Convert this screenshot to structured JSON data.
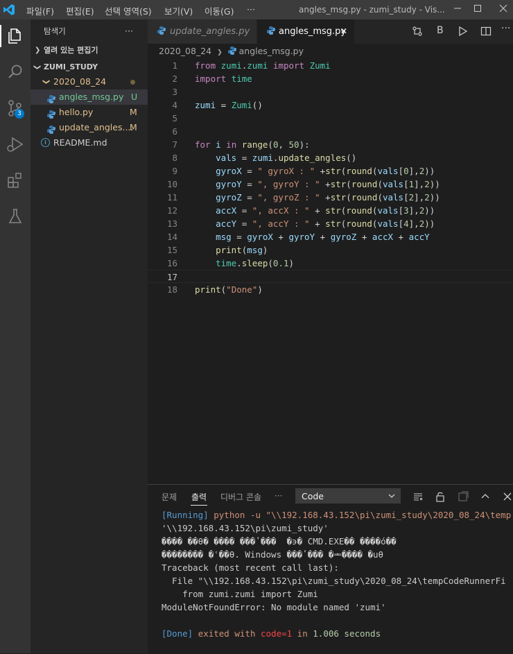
{
  "titlebar": {
    "menus": [
      "파일(F)",
      "편집(E)",
      "선택 영역(S)",
      "보기(V)",
      "이동(G)",
      "···"
    ],
    "window_title": "angles_msg.py - zumi_study - Vis..."
  },
  "activity_bar": {
    "icons": [
      "explorer-icon",
      "search-icon",
      "source-control-icon",
      "run-debug-icon",
      "extensions-icon",
      "testing-icon"
    ],
    "source_control_badge": "3"
  },
  "sidebar": {
    "title": "탐색기",
    "more": "···",
    "open_editors": "열려 있는 편집기",
    "workspace": "ZUMI_STUDY",
    "folder": "2020_08_24",
    "files": [
      {
        "name": "angles_msg.py",
        "status": "U"
      },
      {
        "name": "hello.py",
        "status": "M"
      },
      {
        "name": "update_angles....",
        "status": "M"
      }
    ],
    "readme": "README.md"
  },
  "tabs": [
    {
      "label": "update_angles.py"
    },
    {
      "label": "angles_msg.py",
      "close": "✕"
    }
  ],
  "breadcrumb": {
    "folder": "2020_08_24",
    "file": "angles_msg.py"
  },
  "code": {
    "line_numbers": [
      "1",
      "2",
      "3",
      "4",
      "5",
      "6",
      "7",
      "8",
      "9",
      "10",
      "11",
      "12",
      "13",
      "14",
      "15",
      "16",
      "17",
      "18"
    ],
    "lines": [
      "from zumi.zumi import Zumi",
      "import time",
      "",
      "zumi = Zumi()",
      "",
      "",
      "for i in range(0, 50):",
      "    vals = zumi.update_angles()",
      "    gyroX = \" gyroX : \" +str(round(vals[0],2))",
      "    gyroY = \", gyroY : \" +str(round(vals[1],2))",
      "    gyroZ = \", gyroZ : \" +str(round(vals[2],2))",
      "    accX = \", accX : \" + str(round(vals[3],2))",
      "    accY = \", accY : \" + str(round(vals[4],2))",
      "    msg = gyroX + gyroY + gyroZ + accX + accY",
      "    print(msg)",
      "    time.sleep(0.1)",
      "",
      "print(\"Done\")"
    ]
  },
  "panel": {
    "tabs": [
      "문제",
      "출력",
      "디버그 콘솔",
      "···"
    ],
    "dropdown": "Code",
    "output": {
      "running_tag": "[Running]",
      "running_cmd": " python -u \"\\\\192.168.43.152\\pi\\zumi_study\\2020_08_24\\temp",
      "line2": "'\\\\192.168.43.152\\pi\\zumi_study'",
      "line3": "���� ��θ� ���� ���ʽ���  �϶� CMD.EXE�� ����ó��",
      "line4": "�������� �ʿ��θ. Windows ���ʽ��� �ᆂ���� �սθ",
      "line5": "Traceback (most recent call last):",
      "line6": "  File \"\\\\192.168.43.152\\pi\\zumi_study\\2020_08_24\\tempCodeRunnerFi",
      "line7": "    from zumi.zumi import Zumi",
      "line8": "ModuleNotFoundError: No module named 'zumi'",
      "done_tag": "[Done]",
      "done_text": " exited with ",
      "done_code": "code=1",
      "done_in": " in ",
      "done_time": "1.006 seconds"
    }
  }
}
